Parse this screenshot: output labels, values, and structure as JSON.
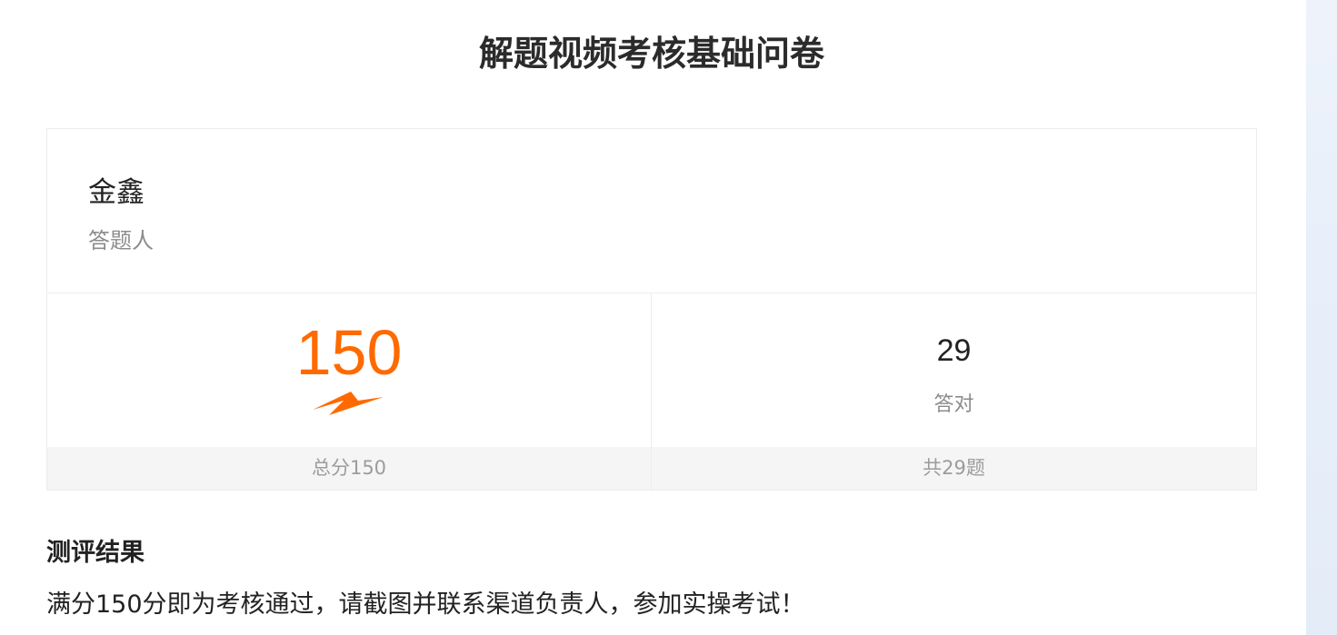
{
  "title": "解题视频考核基础问卷",
  "respondent": {
    "name": "金鑫",
    "label": "答题人"
  },
  "stats": {
    "score": {
      "value": "150",
      "footer": "总分150",
      "color": "#ff6a00",
      "mark_icon": "underline-swoosh-icon"
    },
    "correct": {
      "value": "29",
      "label": "答对",
      "footer": "共29题"
    }
  },
  "result": {
    "heading": "测评结果",
    "text": "满分150分即为考核通过，请截图并联系渠道负责人，参加实操考试！"
  }
}
